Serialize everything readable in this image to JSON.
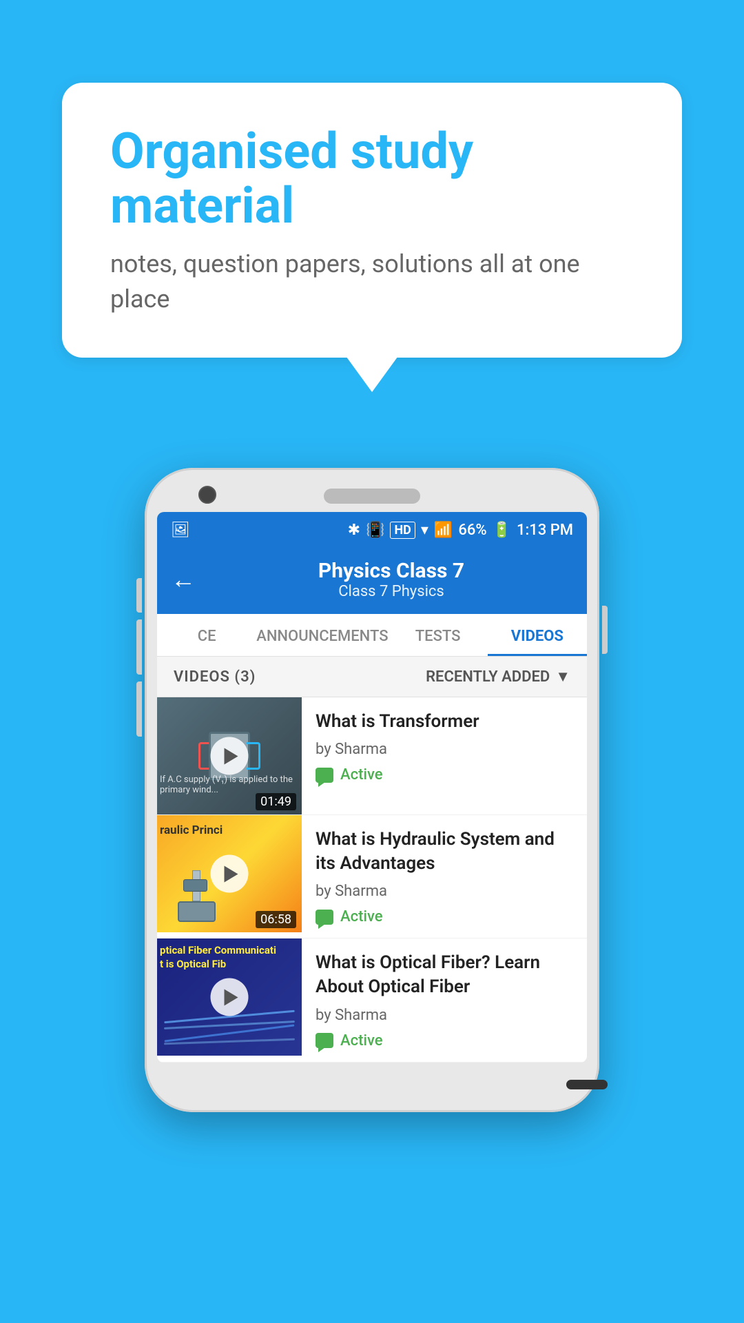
{
  "background_color": "#29b6f6",
  "speech_bubble": {
    "headline": "Organised study material",
    "subtitle": "notes, question papers, solutions all at one place"
  },
  "phone": {
    "status_bar": {
      "time": "1:13 PM",
      "battery": "66%",
      "signal_text": "HD"
    },
    "header": {
      "title": "Physics Class 7",
      "breadcrumb": "Class 7   Physics",
      "back_label": "←"
    },
    "tabs": [
      {
        "label": "CE",
        "active": false
      },
      {
        "label": "ANNOUNCEMENTS",
        "active": false
      },
      {
        "label": "TESTS",
        "active": false
      },
      {
        "label": "VIDEOS",
        "active": true
      }
    ],
    "videos_bar": {
      "count_label": "VIDEOS (3)",
      "sort_label": "RECENTLY ADDED"
    },
    "videos": [
      {
        "title": "What is  Transformer",
        "author": "by Sharma",
        "status": "Active",
        "duration": "01:49",
        "thumb_type": "transformer"
      },
      {
        "title": "What is Hydraulic System and its Advantages",
        "author": "by Sharma",
        "status": "Active",
        "duration": "06:58",
        "thumb_type": "hydraulic",
        "thumb_text_top": "raulic Princi"
      },
      {
        "title": "What is Optical Fiber? Learn About Optical Fiber",
        "author": "by Sharma",
        "status": "Active",
        "duration": "",
        "thumb_type": "optical",
        "thumb_text_top": "ptical Fiber Communicati",
        "thumb_text_bottom": "t is Optical Fib"
      }
    ]
  }
}
